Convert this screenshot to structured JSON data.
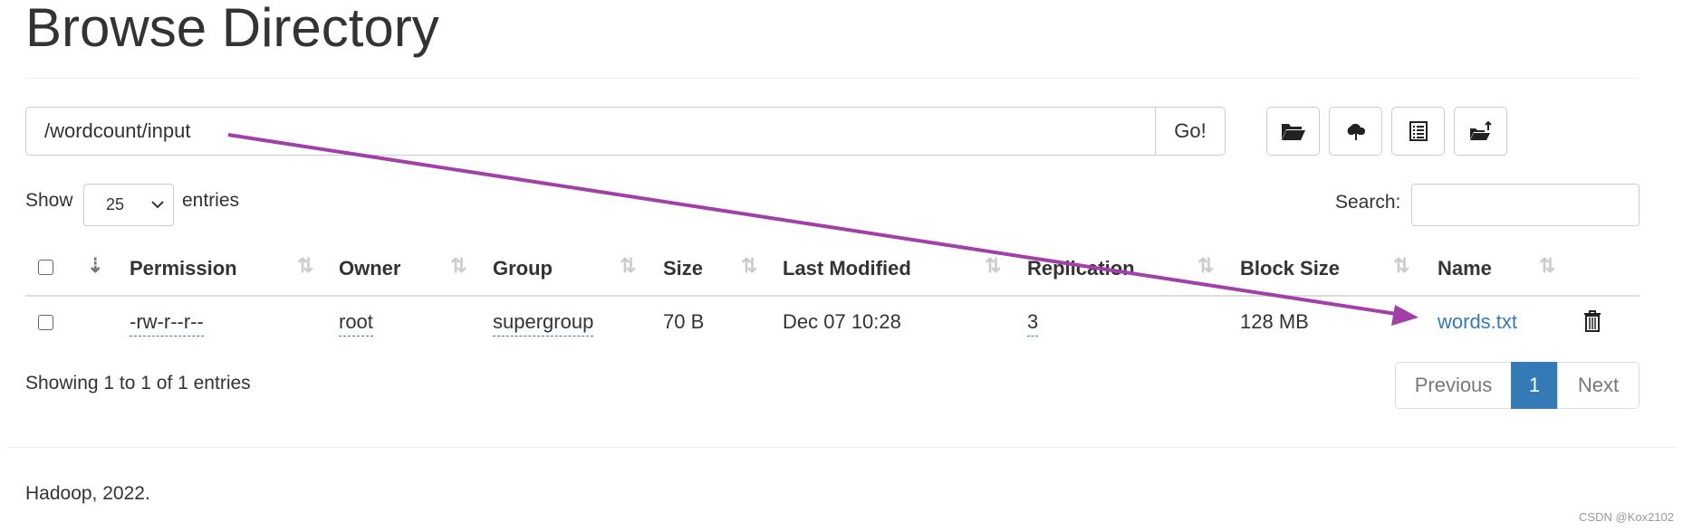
{
  "title": "Browse Directory",
  "path_input": {
    "value": "/wordcount/input"
  },
  "go_label": "Go!",
  "toolbar": [
    {
      "icon": "folder-open-icon"
    },
    {
      "icon": "cloud-upload-icon"
    },
    {
      "icon": "list-alt-icon"
    },
    {
      "icon": "folder-move-icon"
    }
  ],
  "show_label": "Show",
  "entries_select": "25",
  "entries_label": "entries",
  "search_label": "Search:",
  "search_value": "",
  "columns": [
    "Permission",
    "Owner",
    "Group",
    "Size",
    "Last Modified",
    "Replication",
    "Block Size",
    "Name"
  ],
  "rows": [
    {
      "permission": "-rw-r--r--",
      "owner": "root",
      "group": "supergroup",
      "size": "70 B",
      "modified": "Dec 07 10:28",
      "replication": "3",
      "block_size": "128 MB",
      "name": "words.txt"
    }
  ],
  "info": "Showing 1 to 1 of 1 entries",
  "pagination": {
    "previous": "Previous",
    "current": "1",
    "next": "Next"
  },
  "footer": "Hadoop, 2022.",
  "watermark": "CSDN @Kox2102",
  "colors": {
    "link": "#337ab7",
    "annotation_arrow": "#a040a8",
    "active_page": "#337ab7"
  }
}
